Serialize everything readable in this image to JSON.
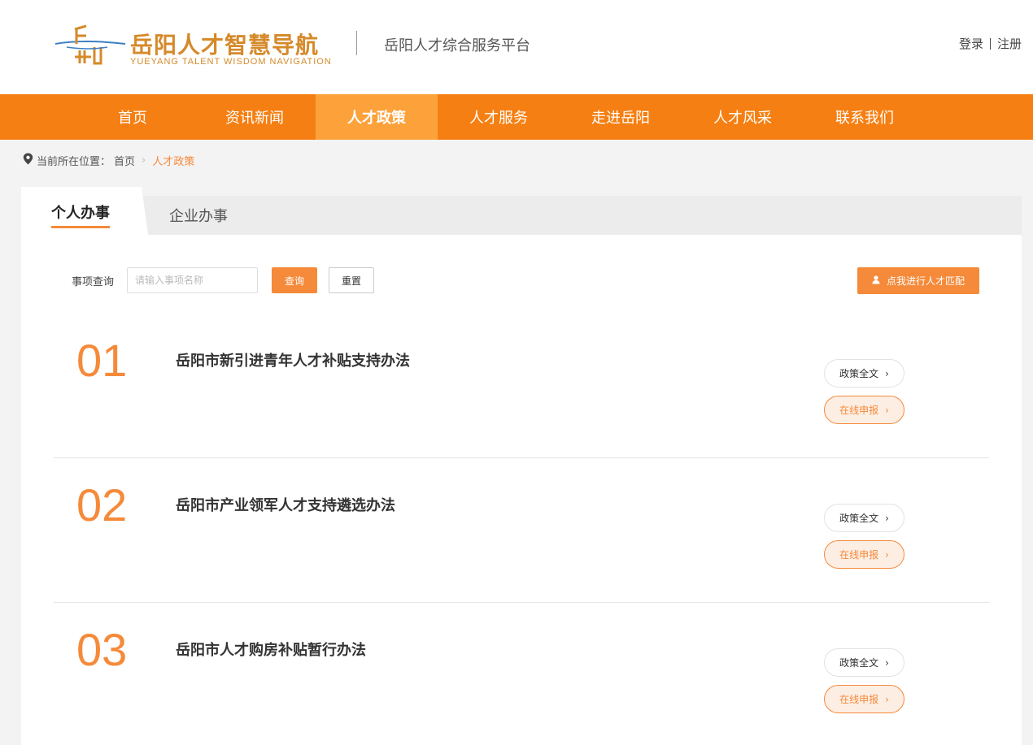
{
  "header": {
    "logo_title": "岳阳人才智慧导航",
    "logo_subtitle": "YUEYANG TALENT WISDOM NAVIGATION",
    "platform_title": "岳阳人才综合服务平台",
    "login": "登录",
    "register": "注册"
  },
  "nav": {
    "items": [
      "首页",
      "资讯新闻",
      "人才政策",
      "人才服务",
      "走进岳阳",
      "人才风采",
      "联系我们"
    ],
    "active": "人才政策"
  },
  "breadcrumb": {
    "prefix": "当前所在位置：",
    "home": "首页",
    "current": "人才政策"
  },
  "tabs": {
    "active": "个人办事",
    "other": "企业办事"
  },
  "search": {
    "label": "事项查询",
    "placeholder": "请输入事项名称",
    "value": "",
    "query_label": "查询",
    "reset_label": "重置",
    "match_label": "点我进行人才匹配"
  },
  "policies": [
    {
      "number": "01",
      "title": "岳阳市新引进青年人才补贴支持办法",
      "full_text_label": "政策全文",
      "apply_label": "在线申报"
    },
    {
      "number": "02",
      "title": "岳阳市产业领军人才支持遴选办法",
      "full_text_label": "政策全文",
      "apply_label": "在线申报"
    },
    {
      "number": "03",
      "title": "岳阳市人才购房补贴暂行办法",
      "full_text_label": "政策全文",
      "apply_label": "在线申报"
    }
  ],
  "colors": {
    "nav_bg": "#f57f12",
    "nav_active": "#fda23a",
    "accent": "#f58a3a",
    "logo": "#d58a2a"
  }
}
